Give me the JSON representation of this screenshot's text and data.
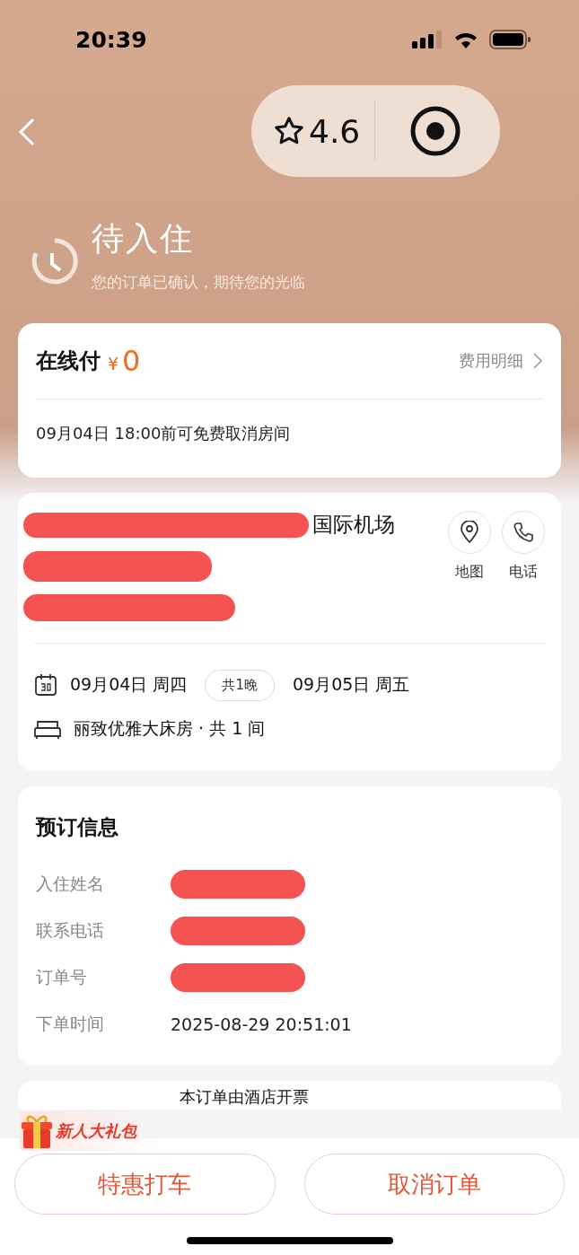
{
  "status_bar": {
    "time": "20:39"
  },
  "rating_pill": {
    "rating": "4.6"
  },
  "order_status": {
    "title": "待入住",
    "subtitle": "您的订单已确认，期待您的光临"
  },
  "payment": {
    "label": "在线付",
    "currency": "¥",
    "amount": "0",
    "details_link": "费用明细",
    "cancel_note": "09月04日 18:00前可免费取消房间"
  },
  "hotel": {
    "name_visible": "国际机场",
    "actions": [
      {
        "kind": "map",
        "label": "地图"
      },
      {
        "kind": "phone",
        "label": "电话"
      }
    ],
    "check_in": "09月04日 周四",
    "nights": "共1晚",
    "check_out": "09月05日 周五",
    "room": "丽致优雅大床房 · 共 1 间"
  },
  "booking_info": {
    "title": "预订信息",
    "rows": [
      {
        "label": "入住姓名",
        "redacted": true
      },
      {
        "label": "联系电话",
        "redacted": true
      },
      {
        "label": "订单号",
        "redacted": true
      },
      {
        "label": "下单时间",
        "value": "2025-08-29 20:51:01",
        "redacted": false
      }
    ]
  },
  "invoice": {
    "note": "本订单由酒店开票"
  },
  "bottom_bar": {
    "promo_badge": "新人大礼包",
    "buttons": [
      "特惠打车",
      "取消订单"
    ]
  }
}
